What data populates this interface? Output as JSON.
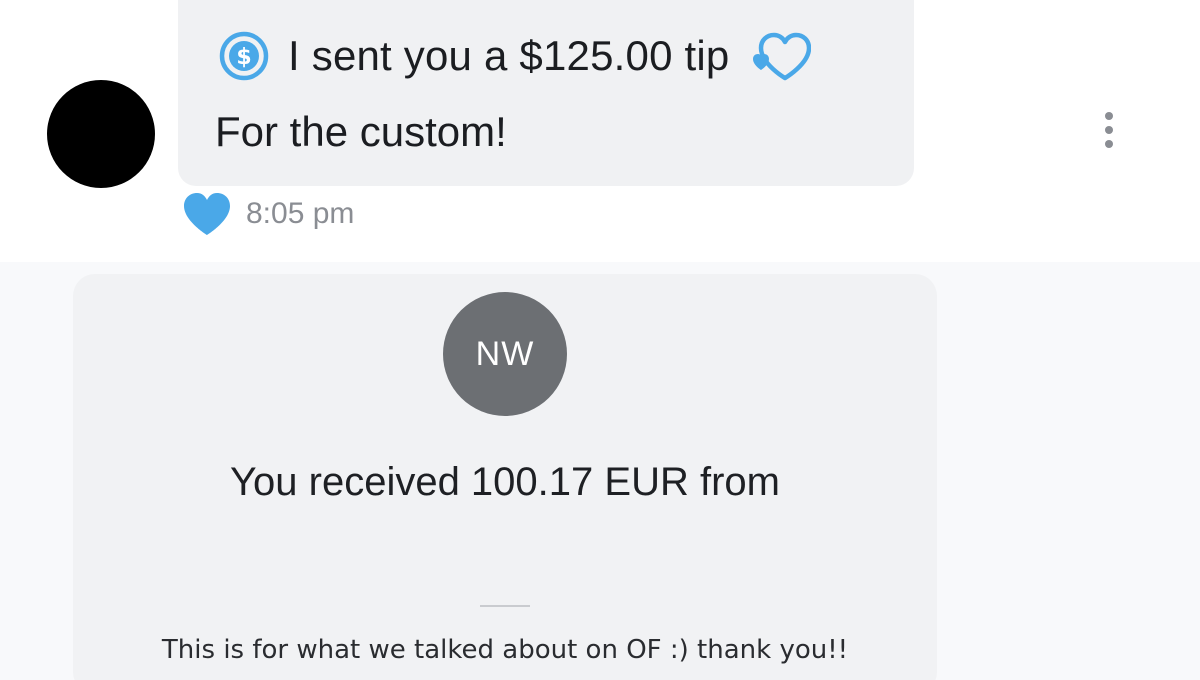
{
  "message": {
    "tip_text": "I sent you a $125.00 tip",
    "body_text": "For the custom!",
    "timestamp": "8:05 pm",
    "icons": {
      "tip": "dollar-circle-icon",
      "tip_decoration": "heart-outline-icon",
      "like": "heart-filled-icon",
      "more": "more-vertical-icon"
    },
    "accent_color": "#4aa8e8"
  },
  "payment_card": {
    "initials": "NW",
    "received_text": "You received 100.17 EUR from",
    "note_text": "This is for what we talked about on OF :) thank you!!"
  }
}
